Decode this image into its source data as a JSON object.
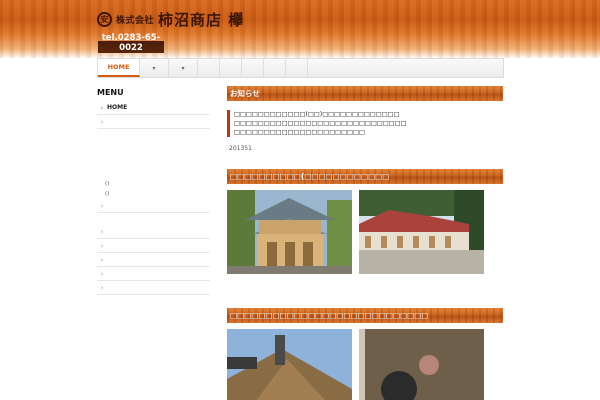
{
  "header": {
    "logo_mark": "安",
    "company_prefix": "株式会社",
    "company_name": "柿沼商店 欅",
    "tel": "tel.0283-65-0022"
  },
  "nav": {
    "items": [
      "HOME",
      "▾",
      "▾",
      "",
      "",
      "",
      "",
      ""
    ]
  },
  "sidebar": {
    "title": "MENU",
    "items": [
      "HOME",
      ""
    ],
    "sub_items": [
      "()",
      "()"
    ],
    "items2": [
      "",
      "",
      "",
      "",
      "",
      ""
    ]
  },
  "main": {
    "notice_title": "お知らせ",
    "notice_lines": [
      "□□□□□□□□□□□□(□□)□□□□□□□□□□□□□",
      "□□□□□□□□□□□□□□□□□□□□□□□□□□□□□",
      "□□□□□□□□□□□□□□□□□□□□□□"
    ],
    "date": "201351",
    "section1_title": "□□□□□□□□□□(□□□□□□□□□□□□",
    "section2_title": "□□□□□□□□□□□□□□□□□□□□□□□□□□□□"
  },
  "colors": {
    "accent": "#c8611c",
    "nav_active": "#d45c10",
    "notice_border": "#b33a0e"
  }
}
